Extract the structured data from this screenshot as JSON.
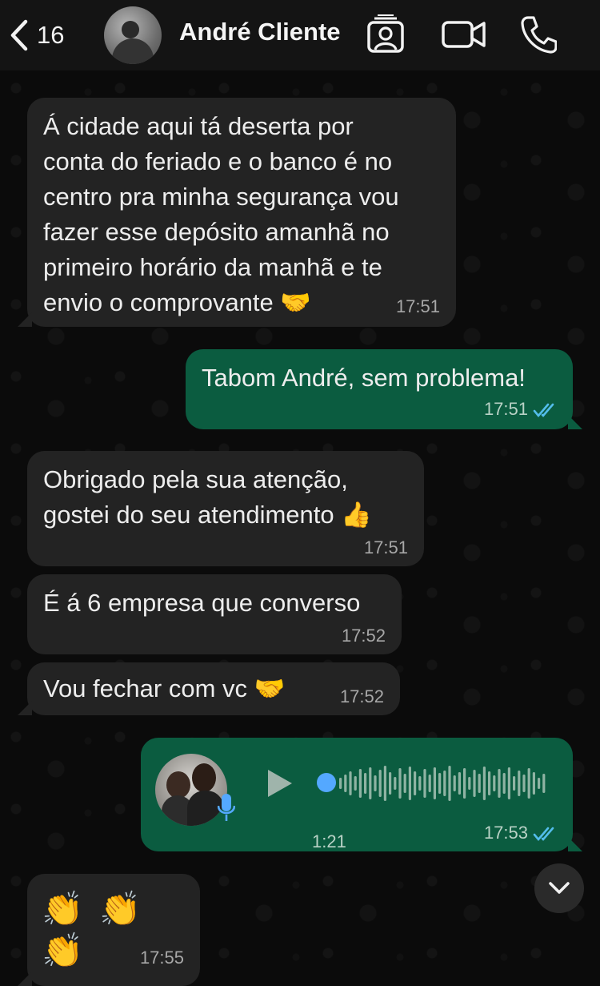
{
  "header": {
    "unread_count": "16",
    "contact_name": "André Cliente"
  },
  "messages": [
    {
      "dir": "in",
      "text": "Á cidade aqui tá deserta por\nconta do feriado e o banco é no\ncentro pra minha segurança vou\nfazer esse depósito amanhã no\nprimeiro horário da manhã e te\nenvio o comprovante 🤝",
      "time": "17:51"
    },
    {
      "dir": "out",
      "text": "Tabom André, sem problema!",
      "time": "17:51",
      "status": "read"
    },
    {
      "dir": "in",
      "text": "Obrigado pela sua atenção,\ngostei do seu atendimento 👍",
      "time": "17:51"
    },
    {
      "dir": "in",
      "text": "É á 6 empresa que converso",
      "time": "17:52"
    },
    {
      "dir": "in",
      "text": "Vou fechar com vc 🤝",
      "time": "17:52"
    },
    {
      "dir": "out",
      "type": "voice",
      "duration": "1:21",
      "time": "17:53",
      "status": "read"
    },
    {
      "dir": "in",
      "text": "👏 👏 👏",
      "time": "17:55"
    }
  ],
  "colors": {
    "incoming_bubble": "#232323",
    "outgoing_bubble": "#0b5c40",
    "read_ticks": "#53bdeb",
    "voice_progress_dot": "#54a8ff"
  },
  "icons": [
    "back-chevron-icon",
    "contact-card-icon",
    "video-call-icon",
    "voice-call-icon",
    "play-icon",
    "mic-icon",
    "double-check-icon",
    "chevron-down-icon"
  ]
}
